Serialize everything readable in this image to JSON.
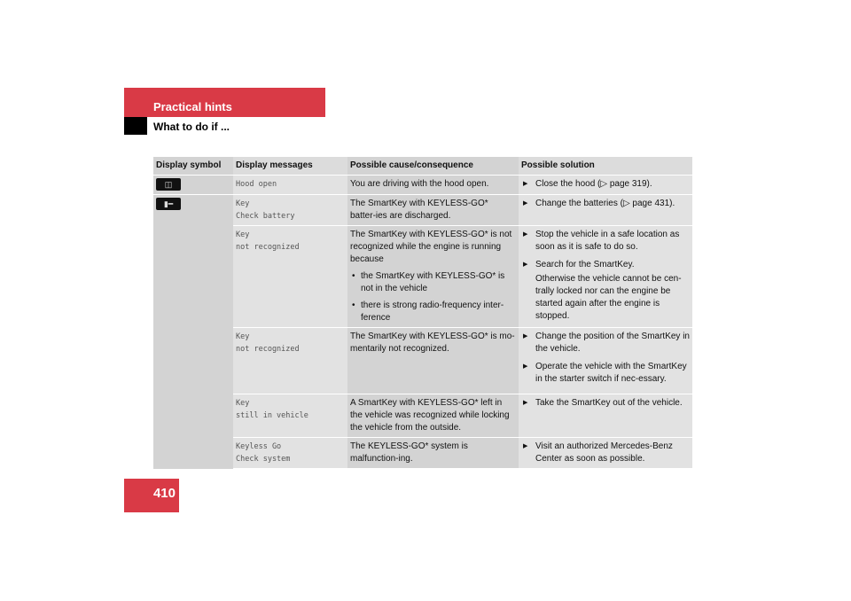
{
  "header": {
    "section": "Practical hints",
    "subsection": "What to do if ..."
  },
  "page_number": "410",
  "table": {
    "headers": [
      "Display symbol",
      "Display messages",
      "Possible cause/consequence",
      "Possible solution"
    ],
    "rows": [
      {
        "symbol": "hood-open-icon",
        "message": [
          "Hood open"
        ],
        "highlight": true,
        "cause": "You are driving with the hood open.",
        "solutions": [
          "Close the hood (▷ page 319)."
        ]
      },
      {
        "symbol": "key-battery-icon",
        "message": [
          "Key",
          "Check battery"
        ],
        "cause": "The SmartKey with KEYLESS-GO* batter-ies are discharged.",
        "solutions": [
          "Change the batteries (▷ page 431)."
        ]
      },
      {
        "message": [
          "Key",
          "not recognized"
        ],
        "highlight": true,
        "cause": "The SmartKey with KEYLESS-GO* is not recognized while the engine is running because",
        "bullets": [
          "the SmartKey with KEYLESS-GO* is not in the vehicle",
          "there is strong radio-frequency inter-ference"
        ],
        "solutions": [
          "Stop the vehicle in a safe location as soon as it is safe to do so.",
          "Search for the SmartKey."
        ],
        "note": "Otherwise the vehicle cannot be cen-trally locked nor can the engine be started again after the engine is stopped."
      },
      {
        "message": [
          "Key",
          "not recognized"
        ],
        "cause": "The SmartKey with KEYLESS-GO* is mo-mentarily not recognized.",
        "solutions": [
          "Change the position of the SmartKey in the vehicle.",
          "Operate the vehicle with the SmartKey in the starter switch if nec-essary."
        ]
      },
      {
        "message": [
          "Key",
          "still in vehicle"
        ],
        "cause": "A SmartKey with KEYLESS-GO* left in the vehicle was recognized while locking the vehicle from the outside.",
        "solutions": [
          "Take the SmartKey out of the vehicle."
        ]
      },
      {
        "message": [
          "Keyless Go",
          "Check system"
        ],
        "cause": "The KEYLESS-GO* system is malfunction-ing.",
        "solutions": [
          "Visit an authorized Mercedes-Benz Center as soon as possible."
        ]
      }
    ]
  }
}
